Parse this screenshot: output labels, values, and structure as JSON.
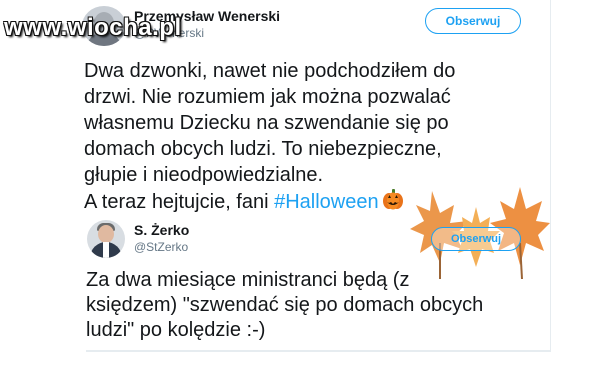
{
  "watermark": {
    "brand": "www.wiocha.pl"
  },
  "tweet": {
    "author_name": "Przemysław Wenerski",
    "author_handle": "@PWenerski",
    "follow_label": "Obserwuj",
    "lines": [
      "Dwa dzwonki, nawet nie podchodziłem do",
      "drzwi. Nie rozumiem jak można pozwalać",
      "własnemu Dziecku na szwendanie się po",
      "domach obcych ludzi. To niebezpieczne,",
      "głupie i nieodpowiedzialne."
    ],
    "last_line_prefix": "A teraz hejtujcie, fani ",
    "hashtag": "#Halloween"
  },
  "reply": {
    "author_name": "S. Żerko",
    "author_handle": "@StZerko",
    "follow_label": "Obserwuj",
    "lines": [
      "Za dwa miesiące ministranci będą (z",
      "księdzem) \"szwendać się po domach obcych",
      "ludzi\" po kolędzie :-)"
    ]
  },
  "icons": {
    "pumpkin": "pumpkin-icon",
    "leaves": "maple-leaves-icon"
  },
  "colors": {
    "accent": "#1da1f2",
    "text": "#14171a",
    "muted": "#657786",
    "pumpkin": "#f07f1a",
    "leaf": "#e8862c"
  }
}
